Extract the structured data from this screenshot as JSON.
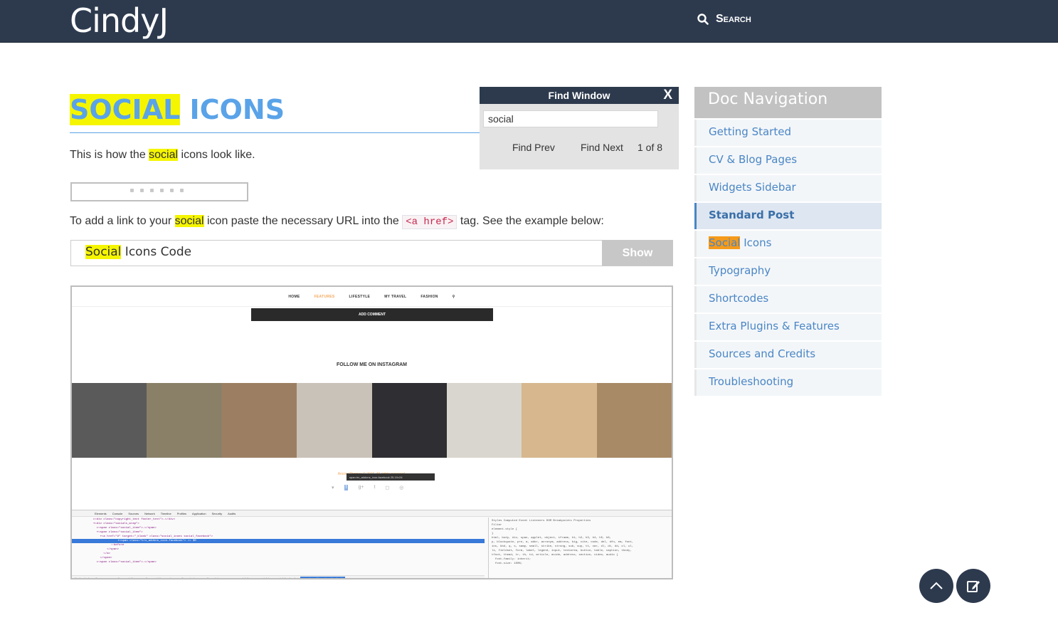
{
  "header": {
    "logo": "CindyJ",
    "search_label": "Search"
  },
  "article": {
    "title_highlight": "SOCIAL",
    "title_rest": " ICONS",
    "p1_before": "This is how the ",
    "p1_highlight": "social",
    "p1_after": " icons look like.",
    "p2_before": "To add a link to your ",
    "p2_highlight": "social",
    "p2_middle": " icon paste the necessary URL into the ",
    "p2_code": "<a href>",
    "p2_after": " tag. See the example below:",
    "codebox_highlight": "Social",
    "codebox_rest": " Icons Code",
    "codebox_button": "Show"
  },
  "embedded_screenshot": {
    "nav": [
      "HOME",
      "FEATURES",
      "LIFESTYLE",
      "MY TRAVEL",
      "FASHION"
    ],
    "comment_button": "ADD COMMENT",
    "follow_heading": "FOLLOW ME ON INSTAGRAM",
    "footer_text": "AncoraThemes © 2016. All rights reserved.",
    "tooltip": "span.trx_addons_icon-facebook  25.19×24",
    "photo_colors": [
      "#5a5a5a",
      "#8a8068",
      "#9c7f62",
      "#c9c2b8",
      "#2f2f33",
      "#d9d6cf",
      "#d7b78e",
      "#a88a66"
    ],
    "devtools_tabs": [
      "Elements",
      "Console",
      "Sources",
      "Network",
      "Timeline",
      "Profiles",
      "Application",
      "Security",
      "Audits"
    ],
    "devtools_lines": [
      "▸<div class=\"copyright_text footer_text\">…</div>",
      "▾<div class=\"socials_wrap\">",
      "  ▸<span class=\"social_item\">…</span>",
      "  ▾<span class=\"social_item\">",
      "    ▾<a href=\"#\" target=\"_blank\" class=\"social_icons social_facebook\">",
      "      ▾<span class=\"trx_addons_icon-facebook\"> == $0",
      "          ::before",
      "        </span>",
      "      </a>",
      "    </span>",
      "  ▸<span class=\"social_item\">…</span>"
    ],
    "devtools_style_tabs": "Styles  Computed  Event Listeners  DOM Breakpoints  Properties",
    "devtools_styles": [
      "Filter",
      "element.style {",
      "}",
      "html, body, div, span, applet, object, iframe, h1, h2, h3, h4, h5, h6,",
      "p, blockquote, pre, a, abbr, acronym, address, big, cite, code, del, dfn, em, font,",
      "ins, kbd, q, s, samp, small, strike, strong, sub, sup, tt, var, dl, dt, dd, ol, ul,",
      "li, fieldset, form, label, legend, input, textarea, button, table, caption, tbody,",
      "tfoot, thead, tr, th, td, article, aside, address, section, video, audio {",
      "  font-family: inherit;",
      "  font-size: 100%;"
    ],
    "devtools_crumbs": [
      "html",
      "body",
      "div.page_wrap",
      "div.copyright_wrap",
      "div.copyright_wrap_inner",
      "div.content_wrap",
      "div.socials_wrap",
      "span.social_item",
      "a.social_icons.social_facebook"
    ],
    "devtools_crumb_active": "span.trx_addons_icon-facebook"
  },
  "find_window": {
    "title": "Find Window",
    "close": "X",
    "query": "social",
    "prev": "Find Prev",
    "next": "Find Next",
    "count": "1 of 8"
  },
  "doc_nav": {
    "title": "Doc Navigation",
    "items": [
      "Getting Started",
      "CV & Blog Pages",
      "Widgets Sidebar",
      "Standard Post",
      "Social Icons",
      "Typography",
      "Shortcodes",
      "Extra Plugins & Features",
      "Sources and Credits",
      "Troubleshooting"
    ],
    "active_item": "Standard Post",
    "social_highlight": "Social",
    "social_rest": " Icons"
  },
  "colors": {
    "header_bg": "#2d3a4e",
    "title_blue": "#5aa3e8",
    "highlight": "#f5f500",
    "current_match": "#f59a1a",
    "nav_link": "#4a86c5"
  },
  "icons": [
    "search-icon",
    "close-icon",
    "chevron-up-icon",
    "edit-icon"
  ]
}
